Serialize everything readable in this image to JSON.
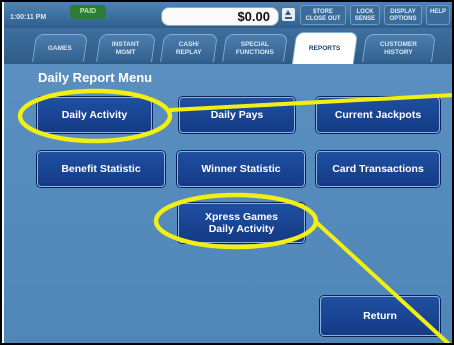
{
  "status_bar": {
    "time": "1:00:11 PM",
    "badge": "PAID",
    "credit": "$0.00",
    "buttons": [
      {
        "label": "$TORE\nCLOSE OUT"
      },
      {
        "label": "LOCK\nSENSE"
      },
      {
        "label": "DISPLAY\nOPTIONS"
      },
      {
        "label": "HELP"
      }
    ]
  },
  "tabs": [
    {
      "label": "GAMES"
    },
    {
      "label": "INSTANT\nMGMT"
    },
    {
      "label": "CASH/\nREPLAY"
    },
    {
      "label": "SPECIAL\nFUNCTIONS"
    },
    {
      "label": "REPORTS"
    },
    {
      "label": "CUSTOMER\nHISTORY"
    }
  ],
  "menu": {
    "title": "Daily Report Menu",
    "buttons": {
      "daily_activity": "Daily Activity",
      "daily_pays": "Daily Pays",
      "current_jackpots": "Current Jackpots",
      "benefit_statistic": "Benefit Statistic",
      "winner_statistic": "Winner Statistic",
      "card_transactions": "Card Transactions",
      "xpress_line1": "Xpress Games",
      "xpress_line2": "Daily Activity",
      "return": "Return"
    }
  },
  "annotation_color": "#f2ef12"
}
